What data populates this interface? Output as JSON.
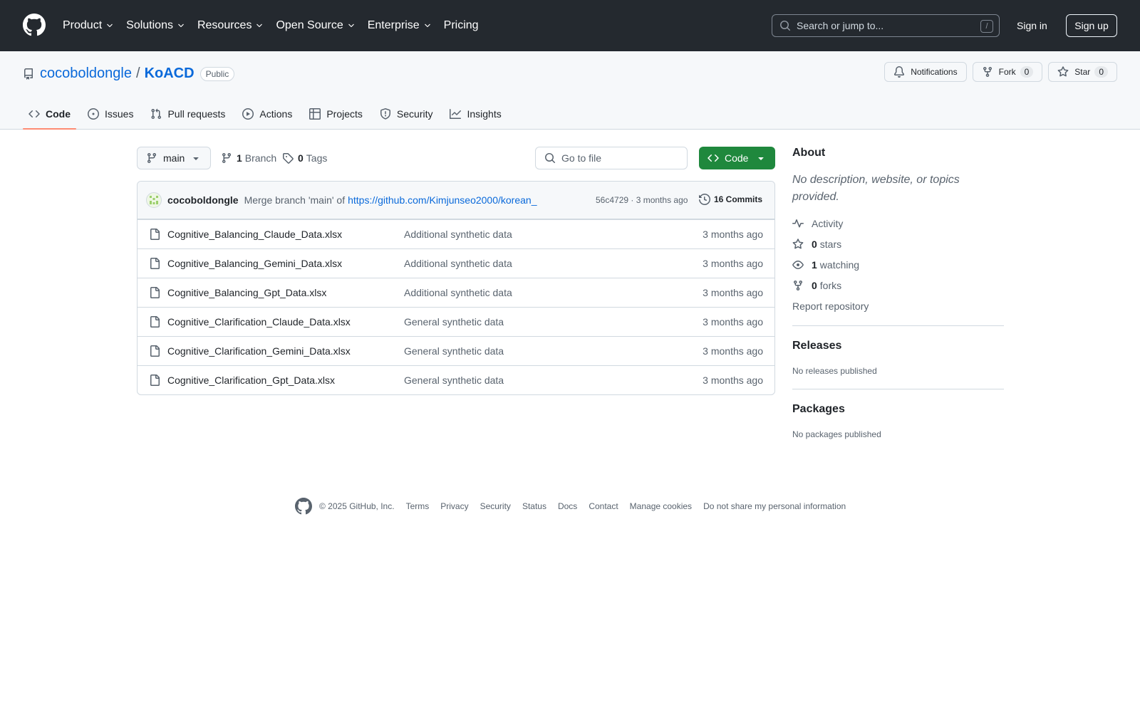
{
  "header": {
    "nav": [
      {
        "label": "Product",
        "dropdown": true
      },
      {
        "label": "Solutions",
        "dropdown": true
      },
      {
        "label": "Resources",
        "dropdown": true
      },
      {
        "label": "Open Source",
        "dropdown": true
      },
      {
        "label": "Enterprise",
        "dropdown": true
      },
      {
        "label": "Pricing",
        "dropdown": false
      }
    ],
    "search_placeholder": "Search or jump to...",
    "search_shortcut": "/",
    "sign_in": "Sign in",
    "sign_up": "Sign up"
  },
  "repo": {
    "owner": "cocoboldongle",
    "separator": "/",
    "name": "KoACD",
    "visibility": "Public",
    "notifications_label": "Notifications",
    "fork_label": "Fork",
    "fork_count": "0",
    "star_label": "Star",
    "star_count": "0",
    "tabs": [
      {
        "label": "Code",
        "icon": "code-icon",
        "active": true
      },
      {
        "label": "Issues",
        "icon": "issue-icon",
        "active": false
      },
      {
        "label": "Pull requests",
        "icon": "pull-request-icon",
        "active": false
      },
      {
        "label": "Actions",
        "icon": "play-icon",
        "active": false
      },
      {
        "label": "Projects",
        "icon": "table-icon",
        "active": false
      },
      {
        "label": "Security",
        "icon": "shield-icon",
        "active": false
      },
      {
        "label": "Insights",
        "icon": "graph-icon",
        "active": false
      }
    ]
  },
  "toolbar": {
    "branch": "main",
    "branch_count": "1",
    "branch_label": "Branch",
    "tag_count": "0",
    "tag_label": "Tags",
    "goto_file_placeholder": "Go to file",
    "code_button": "Code"
  },
  "commit": {
    "author": "cocoboldongle",
    "message": "Merge branch 'main' of",
    "link": "https://github.com/Kimjunseo2000/korean_",
    "sha_time": "56c4729 · 3 months ago",
    "commits_label": "16 Commits"
  },
  "files": [
    {
      "name": "Cognitive_Balancing_Claude_Data.xlsx",
      "message": "Additional synthetic data",
      "date": "3 months ago"
    },
    {
      "name": "Cognitive_Balancing_Gemini_Data.xlsx",
      "message": "Additional synthetic data",
      "date": "3 months ago"
    },
    {
      "name": "Cognitive_Balancing_Gpt_Data.xlsx",
      "message": "Additional synthetic data",
      "date": "3 months ago"
    },
    {
      "name": "Cognitive_Clarification_Claude_Data.xlsx",
      "message": "General synthetic data",
      "date": "3 months ago"
    },
    {
      "name": "Cognitive_Clarification_Gemini_Data.xlsx",
      "message": "General synthetic data",
      "date": "3 months ago"
    },
    {
      "name": "Cognitive_Clarification_Gpt_Data.xlsx",
      "message": "General synthetic data",
      "date": "3 months ago"
    }
  ],
  "about": {
    "title": "About",
    "description": "No description, website, or topics provided.",
    "activity": "Activity",
    "stars_count": "0",
    "stars_label": "stars",
    "watching_count": "1",
    "watching_label": "watching",
    "forks_count": "0",
    "forks_label": "forks",
    "report": "Report repository"
  },
  "releases": {
    "title": "Releases",
    "empty": "No releases published"
  },
  "packages": {
    "title": "Packages",
    "empty": "No packages published"
  },
  "footer": {
    "copyright": "© 2025 GitHub, Inc.",
    "links": [
      "Terms",
      "Privacy",
      "Security",
      "Status",
      "Docs",
      "Contact",
      "Manage cookies",
      "Do not share my personal information"
    ]
  },
  "colors": {
    "header_bg": "#24292f",
    "link": "#0969da",
    "primary_button": "#1f883d",
    "active_tab_underline": "#fd8c73"
  }
}
